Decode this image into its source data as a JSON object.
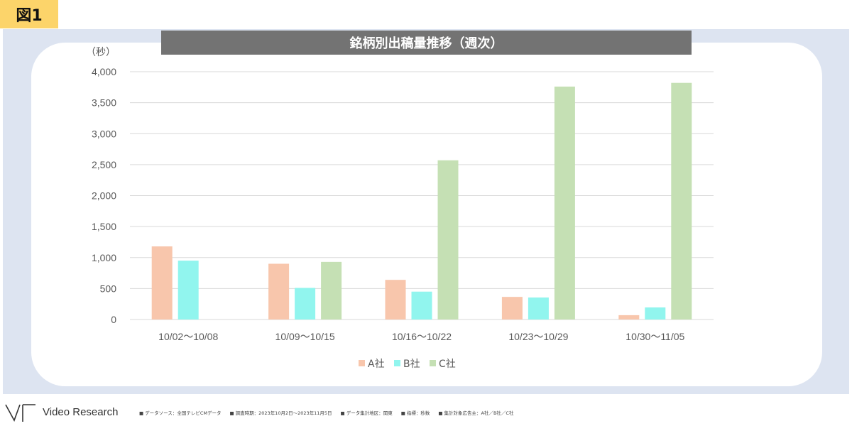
{
  "figure_label": "図1",
  "brand": {
    "name": "Video Research"
  },
  "footer_notes": [
    "データソース：全国テレビCMデータ",
    "調査時期：2023年10月2日～2023年11月5日",
    "データ集計地区：関東",
    "指標：秒数",
    "集計対象広告主：A社／B社／C社"
  ],
  "colors": {
    "A": "#f8c6ac",
    "B": "#91f5ee",
    "C": "#c5e0b4",
    "grid": "#d9d9d9",
    "axis_text": "#595959"
  },
  "chart_data": {
    "type": "bar",
    "title": "銘柄別出稿量推移（週次）",
    "ylabel": "（秒）",
    "xlabel": "",
    "ylim": [
      0,
      4000
    ],
    "yticks": [
      0,
      500,
      1000,
      1500,
      2000,
      2500,
      3000,
      3500,
      4000
    ],
    "ytick_labels": [
      "0",
      "500",
      "1,000",
      "1,500",
      "2,000",
      "2,500",
      "3,000",
      "3,500",
      "4,000"
    ],
    "grid": true,
    "legend_position": "bottom",
    "categories": [
      "10/02～10/08",
      "10/09～10/15",
      "10/16～10/22",
      "10/23～10/29",
      "10/30～11/05"
    ],
    "series": [
      {
        "name": "A社",
        "values": [
          1180,
          900,
          640,
          365,
          70
        ]
      },
      {
        "name": "B社",
        "values": [
          950,
          510,
          450,
          355,
          195
        ]
      },
      {
        "name": "C社",
        "values": [
          0,
          930,
          2570,
          3760,
          3820
        ]
      }
    ]
  }
}
